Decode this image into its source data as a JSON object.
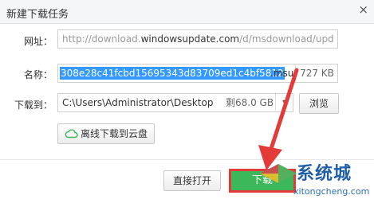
{
  "dialog": {
    "title": "新建下载任务",
    "close_glyph": "×"
  },
  "url_row": {
    "label": "网址：",
    "prefix": "http://download.",
    "domain": "windowsupdate.com",
    "suffix": "/d/msdownload/upd"
  },
  "name_row": {
    "label": "名称：",
    "selected_text": "308e28c41fcbd15695343d83709ed1c4bf5812",
    "extension": ".msu",
    "size": "727 KB"
  },
  "path_row": {
    "label": "下载到：",
    "value": "C:\\Users\\Administrator\\Desktop",
    "free_space": "剩68.0 GB",
    "dropdown_glyph": "▾",
    "browse_label": "浏览"
  },
  "cloud_button": {
    "label": "离线下载到云盘"
  },
  "footer": {
    "open_label": "直接打开",
    "download_label": "下载"
  },
  "watermark": {
    "brand": "系统城",
    "url": "xitongcheng.com"
  },
  "colors": {
    "selection": "#3399ff",
    "download_button": "#3cb85b",
    "highlight_arrow": "#e53a3a",
    "cloud_icon": "#3cb85b"
  }
}
